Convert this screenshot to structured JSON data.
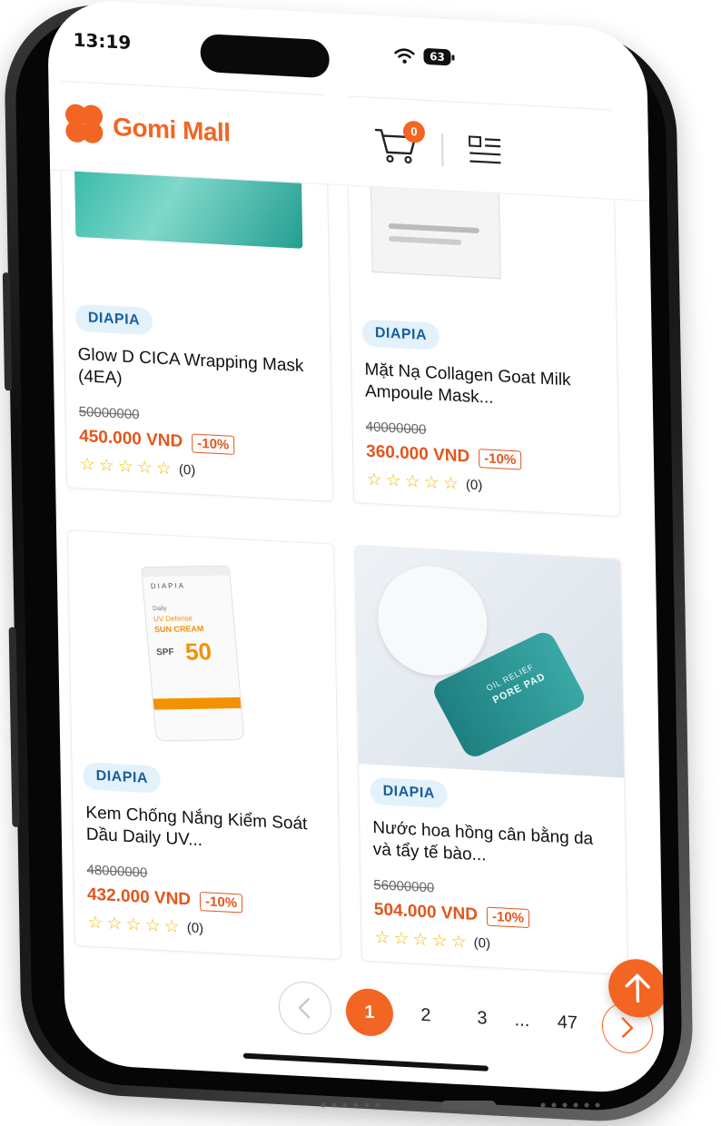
{
  "status": {
    "time": "13:19",
    "battery": "63"
  },
  "header": {
    "logo_text": "Gomi Mall",
    "cart_count": "0"
  },
  "products": [
    {
      "brand": "DIAPIA",
      "name": "Glow D CICA Wrapping Mask (4EA)",
      "old_price": "50000000",
      "price": "450.000 VND",
      "discount": "-10%",
      "rating_count": "(0)"
    },
    {
      "brand": "DIAPIA",
      "name": "Mặt Nạ Collagen Goat Milk Ampoule Mask...",
      "old_price": "40000000",
      "price": "360.000 VND",
      "discount": "-10%",
      "rating_count": "(0)"
    },
    {
      "brand": "DIAPIA",
      "name": "Kem Chống Nắng Kiểm Soát Dầu Daily UV...",
      "old_price": "48000000",
      "price": "432.000 VND",
      "discount": "-10%",
      "rating_count": "(0)"
    },
    {
      "brand": "DIAPIA",
      "name": "Nước hoa hồng cân bằng da và tẩy tế bào...",
      "old_price": "56000000",
      "price": "504.000 VND",
      "discount": "-10%",
      "rating_count": "(0)"
    }
  ],
  "product_images": {
    "sunscreen_brand": "DIAPIA",
    "sunscreen_line1": "Daily",
    "sunscreen_line2": "UV Defense",
    "sunscreen_line3": "SUN CREAM",
    "sunscreen_spf": "SPF",
    "sunscreen_spf_value": "50",
    "pad_line1": "OIL RELIEF",
    "pad_line2": "PORE PAD"
  },
  "pagination": {
    "current": "1",
    "pages": [
      "2",
      "3"
    ],
    "ellipsis": "...",
    "last": "47"
  },
  "colors": {
    "accent": "#f26522",
    "price": "#e2561c",
    "brand_bg": "#e3f1fb",
    "brand_text": "#1a5e9a",
    "star": "#f5b800"
  },
  "icons": {
    "cart": "cart-icon",
    "menu": "menu-icon",
    "prev": "chevron-left-icon",
    "next": "chevron-right-icon",
    "scroll_top": "arrow-up-icon"
  }
}
